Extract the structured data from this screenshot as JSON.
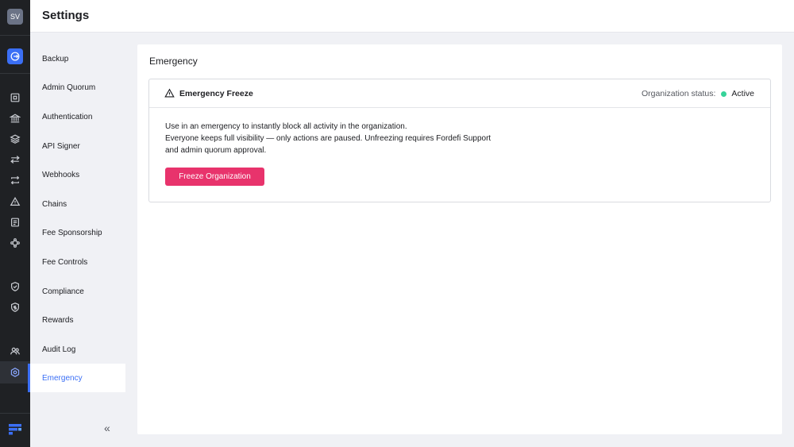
{
  "header": {
    "title": "Settings"
  },
  "rail": {
    "avatar_initials": "SV",
    "icons": [
      "switch-org-icon",
      "dashboard-icon",
      "bank-icon",
      "layers-icon",
      "transfer-icon",
      "swap-icon",
      "alert-icon",
      "document-icon",
      "network-icon",
      "shield-check-icon",
      "shield-dollar-icon",
      "users-icon",
      "settings-icon",
      "fordefi-logo-icon"
    ]
  },
  "subnav": {
    "items": [
      {
        "label": "Backup"
      },
      {
        "label": "Admin Quorum"
      },
      {
        "label": "Authentication"
      },
      {
        "label": "API Signer"
      },
      {
        "label": "Webhooks"
      },
      {
        "label": "Chains"
      },
      {
        "label": "Fee Sponsorship"
      },
      {
        "label": "Fee Controls"
      },
      {
        "label": "Compliance"
      },
      {
        "label": "Rewards"
      },
      {
        "label": "Audit Log"
      },
      {
        "label": "Emergency"
      }
    ],
    "active": "Emergency",
    "collapse_label": "«"
  },
  "main": {
    "heading": "Emergency",
    "card": {
      "title": "Emergency Freeze",
      "status_label": "Organization status:",
      "status_value": "Active",
      "status_color": "#36d399",
      "description": [
        "Use in an emergency to instantly block all activity in the organization.",
        "Everyone keeps full visibility — only actions are paused. Unfreezing requires Fordefi Support",
        "and admin quorum approval."
      ],
      "button_label": "Freeze Organization",
      "button_color": "#e8336c"
    }
  },
  "colors": {
    "accent": "#3b6ff5",
    "rail_bg": "#1f2124"
  }
}
